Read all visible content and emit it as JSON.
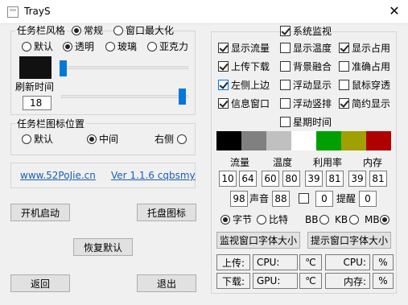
{
  "window": {
    "title": "TrayS",
    "close_glyph": "✕"
  },
  "taskbar_style": {
    "title": "任务栏风格",
    "opt_normal": "常规",
    "opt_maximized": "窗口最大化",
    "opt_default": "默认",
    "opt_transparent": "透明",
    "opt_glass": "玻璃",
    "opt_acrylic": "亚克力",
    "color_preview": "#111111",
    "refresh_label": "刷新时间",
    "refresh_value": "18"
  },
  "icon_position": {
    "title": "任务栏图标位置",
    "opt_default": "默认",
    "opt_center": "中间",
    "opt_right": "右侧"
  },
  "links": {
    "site": "www.52PoJie.cn",
    "version": "Ver 1.1.6 cqbsmy"
  },
  "buttons": {
    "autostart": "开机启动",
    "tray_icon": "托盘图标",
    "restore": "恢复默认",
    "back": "返回",
    "exit": "退出"
  },
  "monitor": {
    "title": "系统监视",
    "show_traffic": "显示流量",
    "show_temp": "显示温度",
    "show_usage": "显示占用",
    "upload_download": "上传下载",
    "bg_blend": "背景融合",
    "accurate_usage": "准确占用",
    "left_top": "左侧上边",
    "float_display": "浮动显示",
    "mouse_through": "鼠标穿透",
    "info_window": "信息窗口",
    "float_vertical": "浮动竖排",
    "simple_display": "简约显示",
    "weekday_time": "星期时间",
    "swatches": [
      "#000000",
      "#808080",
      "#c0c0c0",
      "#ffffff",
      "#00a000",
      "#a0a000",
      "#b00000"
    ],
    "col_traffic": "流量",
    "col_temp": "温度",
    "col_usage": "利用率",
    "col_memory": "内存",
    "thresholds": [
      "10",
      "64",
      "60",
      "80",
      "39",
      "81",
      "39",
      "81"
    ],
    "sound_value": "98",
    "sound_label": "声音",
    "sound_value2": "88",
    "remind_value1": "0",
    "remind_label": "提醒",
    "remind_value2": "0",
    "unit_byte": "字节",
    "unit_bit": "比特",
    "unit_bb": "BB",
    "unit_kb": "KB",
    "unit_mb": "MB",
    "btn_monitor_font": "监视窗口字体大小",
    "btn_tip_font": "提示窗口字体大小",
    "upload": "上传:",
    "cpu": "CPU:",
    "celsius": "℃",
    "cpu2": "CPU:",
    "percent": "%",
    "download": "下载:",
    "gpu": "GPU:",
    "celsius2": "℃",
    "memory": "内存:",
    "percent2": "%"
  }
}
